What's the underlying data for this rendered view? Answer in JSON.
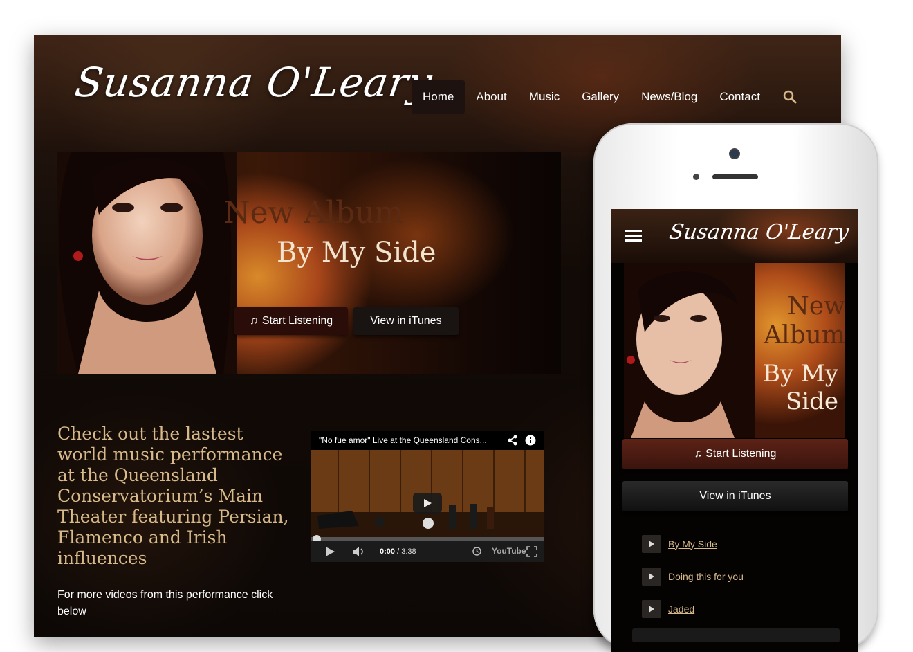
{
  "site": {
    "logo_text": "Susanna O'Leary",
    "nav": [
      {
        "label": "Home",
        "active": true
      },
      {
        "label": "About",
        "active": false
      },
      {
        "label": "Music",
        "active": false
      },
      {
        "label": "Gallery",
        "active": false
      },
      {
        "label": "News/Blog",
        "active": false
      },
      {
        "label": "Contact",
        "active": false
      }
    ],
    "search_icon": "search-icon"
  },
  "hero": {
    "title": "New Album",
    "subtitle": "By My Side",
    "listen_label": "Start Listening",
    "itunes_label": "View in iTunes"
  },
  "promo": {
    "headline": "Check out the lastest world music performance at the Queensland Conservatorium’s Main Theater featuring Persian, Flamenco and Irish influences",
    "note": "For more videos from this performance click below"
  },
  "video": {
    "title": "\"No fue amor\" Live at the Queensland Cons...",
    "current_time": "0:00",
    "duration": "/ 3:38",
    "brand": "YouTube",
    "progress": 0
  },
  "mobile": {
    "logo_text": "Susanna O'Leary",
    "title": "New Album",
    "subtitle": "By My Side",
    "listen_label": "Start Listening",
    "itunes_label": "View in iTunes",
    "tracks": [
      "By My Side",
      "Doing this for you",
      "Jaded"
    ]
  },
  "colors": {
    "accent_gold": "#d7b98a",
    "listen_button": "#2a0d08",
    "nav_active_bg": "#1d1210"
  }
}
